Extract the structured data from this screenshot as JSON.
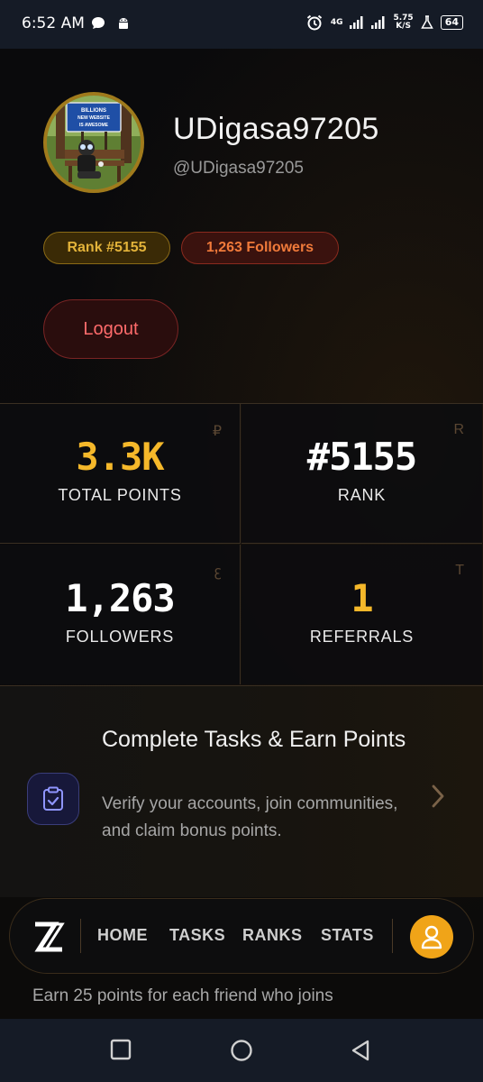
{
  "status_bar": {
    "time": "6:52 AM",
    "network_label": "4G",
    "speed_value": "5.75",
    "speed_unit": "K/S",
    "battery": "64"
  },
  "profile": {
    "avatar_sign_lines": [
      "BILLIONS",
      "NEW WEBSITE",
      "IS AWESOME"
    ],
    "username": "UDigasa97205",
    "handle": "@UDigasa97205",
    "rank_badge": "Rank #5155",
    "followers_badge": "1,263 Followers",
    "logout_label": "Logout"
  },
  "stats": [
    {
      "value": "3.3K",
      "label": "TOTAL POINTS",
      "glyph": "₽"
    },
    {
      "value": "#5155",
      "label": "RANK",
      "glyph": "R"
    },
    {
      "value": "1,263",
      "label": "FOLLOWERS",
      "glyph": "ꜫ"
    },
    {
      "value": "1",
      "label": "REFERRALS",
      "glyph": "T"
    }
  ],
  "task_card": {
    "title": "Complete Tasks & Earn Points",
    "description": "Verify your accounts, join communities, and claim bonus points."
  },
  "nav": {
    "items": [
      "HOME",
      "TASKS",
      "RANKS",
      "STATS"
    ]
  },
  "referral_note": "Earn 25 points for each friend who joins",
  "colors": {
    "gold": "#f5b82a",
    "accent_orange": "#f0a418",
    "logout_red": "#ff6b6b",
    "followers_orange": "#f07a3a"
  }
}
